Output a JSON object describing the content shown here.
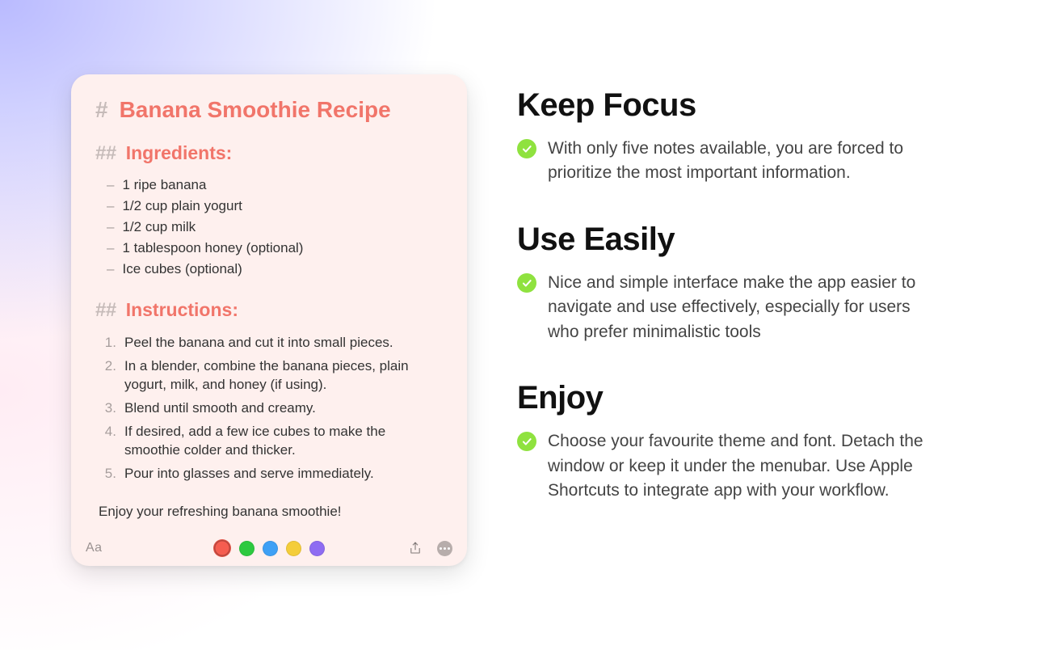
{
  "note": {
    "h1_hash": "#",
    "h1": "Banana Smoothie Recipe",
    "h2_hash": "##",
    "ingredients_heading": "Ingredients:",
    "ingredients": [
      "1 ripe banana",
      "1/2 cup plain yogurt",
      "1/2 cup milk",
      "1 tablespoon honey (optional)",
      "Ice cubes (optional)"
    ],
    "instructions_heading": "Instructions:",
    "instructions": [
      "Peel the banana and cut it into small pieces.",
      "In a blender, combine the banana pieces, plain yogurt, milk, and honey (if using).",
      "Blend until smooth and creamy.",
      "If desired, add a few ice cubes to make the smoothie colder and thicker.",
      "Pour into glasses and serve immediately."
    ],
    "closing": "Enjoy your refreshing banana smoothie!",
    "toolbar": {
      "font_label": "Aa",
      "colors": [
        {
          "name": "red",
          "hex": "#F55D50",
          "selected": true
        },
        {
          "name": "green",
          "hex": "#2DC93F",
          "selected": false
        },
        {
          "name": "blue",
          "hex": "#3EA0F5",
          "selected": false
        },
        {
          "name": "yellow",
          "hex": "#F4CD3A",
          "selected": false
        },
        {
          "name": "purple",
          "hex": "#8E6CF2",
          "selected": false
        }
      ]
    }
  },
  "features": [
    {
      "title": "Keep Focus",
      "body": "With only five notes available, you are forced to prioritize the most important information."
    },
    {
      "title": "Use Easily",
      "body": "Nice and simple interface make the app easier to navigate and use effectively, especially for users who prefer minimalistic tools"
    },
    {
      "title": "Enjoy",
      "body": "Choose your favourite theme and font. Detach the window or keep it under the menubar. Use Apple Shortcuts to integrate app with your workflow."
    }
  ]
}
